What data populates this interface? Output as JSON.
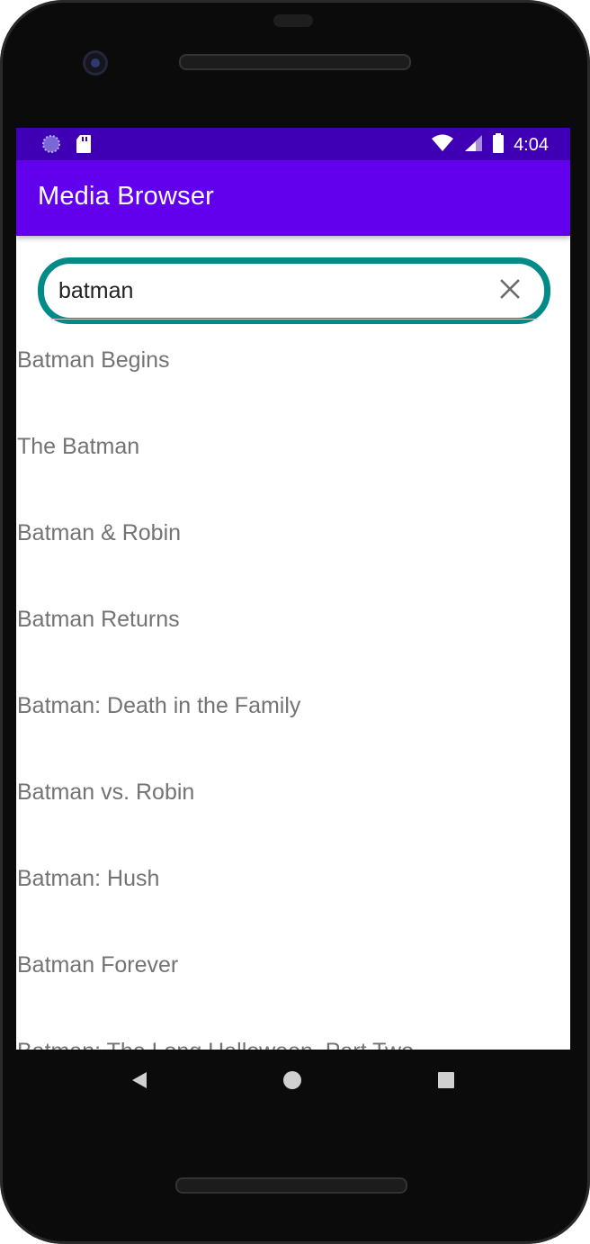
{
  "status_bar": {
    "time": "4:04",
    "left_icons": [
      "loader-icon",
      "sd-card-icon"
    ],
    "right_icons": [
      "wifi-icon",
      "signal-icon",
      "battery-icon"
    ]
  },
  "app_bar": {
    "title": "Media Browser",
    "color": "#6200ee",
    "status_color": "#3f00b5"
  },
  "search": {
    "value": "batman",
    "accent_color": "#008a88",
    "clear_icon": "close-icon"
  },
  "results": [
    "Batman Begins",
    "The Batman",
    "Batman & Robin",
    "Batman Returns",
    "Batman: Death in the Family",
    "Batman vs. Robin",
    "Batman: Hush",
    "Batman Forever",
    "Batman: The Long Halloween, Part Two"
  ],
  "nav_bar": {
    "buttons": [
      "back-icon",
      "home-icon",
      "recents-icon"
    ]
  }
}
